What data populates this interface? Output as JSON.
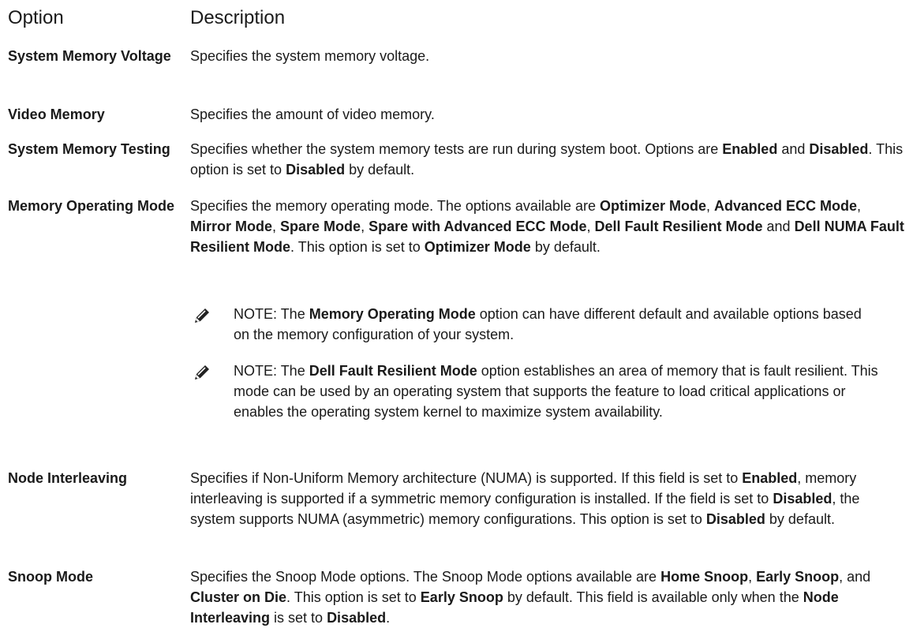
{
  "header": {
    "option": "Option",
    "description": "Description"
  },
  "rows": [
    {
      "option": "System Memory Voltage",
      "desc": [
        {
          "t": "Specifies the system memory voltage."
        }
      ]
    },
    {
      "option": "Video Memory",
      "desc": [
        {
          "t": "Specifies the amount of video memory."
        }
      ]
    },
    {
      "option": "System Memory Testing",
      "desc": [
        {
          "t": "Specifies whether the system memory tests are run during system boot. Options are "
        },
        {
          "t": "Enabled",
          "b": true
        },
        {
          "t": " and "
        },
        {
          "t": "Disabled",
          "b": true
        },
        {
          "t": ". This option is set to "
        },
        {
          "t": "Disabled",
          "b": true
        },
        {
          "t": " by default."
        }
      ]
    },
    {
      "option": "Memory Operating Mode",
      "desc": [
        {
          "t": "Specifies the memory operating mode. The options available are "
        },
        {
          "t": "Optimizer Mode",
          "b": true
        },
        {
          "t": ", "
        },
        {
          "t": "Advanced ECC Mode",
          "b": true
        },
        {
          "t": ", "
        },
        {
          "t": "Mirror Mode",
          "b": true
        },
        {
          "t": ", "
        },
        {
          "t": "Spare Mode",
          "b": true
        },
        {
          "t": ", "
        },
        {
          "t": "Spare with Advanced ECC Mode",
          "b": true
        },
        {
          "t": ", "
        },
        {
          "t": "Dell Fault Resilient Mode",
          "b": true
        },
        {
          "t": " and "
        },
        {
          "t": "Dell NUMA Fault Resilient Mode",
          "b": true
        },
        {
          "t": ". This option is set to "
        },
        {
          "t": "Optimizer Mode",
          "b": true
        },
        {
          "t": " by default."
        }
      ],
      "notes": [
        {
          "label": "NOTE:",
          "text": [
            {
              "t": " The "
            },
            {
              "t": "Memory Operating Mode",
              "b": true
            },
            {
              "t": " option can have different default and available options based on the memory configuration of your system."
            }
          ]
        },
        {
          "label": "NOTE:",
          "text": [
            {
              "t": " The "
            },
            {
              "t": "Dell Fault Resilient Mode",
              "b": true
            },
            {
              "t": " option establishes an area of memory that is fault resilient. This mode can be used by an operating system that supports the feature to load critical applications or enables the operating system kernel to maximize system availability."
            }
          ]
        }
      ]
    },
    {
      "option": "Node Interleaving",
      "desc": [
        {
          "t": "Specifies if Non-Uniform Memory architecture (NUMA) is supported. If this field is set to "
        },
        {
          "t": "Enabled",
          "b": true
        },
        {
          "t": ", memory interleaving is supported if a symmetric memory configuration is installed. If the field is set to "
        },
        {
          "t": "Disabled",
          "b": true
        },
        {
          "t": ", the system supports NUMA (asymmetric) memory configurations. This option is set to "
        },
        {
          "t": "Disabled",
          "b": true
        },
        {
          "t": " by default."
        }
      ]
    },
    {
      "option": "Snoop Mode",
      "desc": [
        {
          "t": "Specifies the Snoop Mode options. The Snoop Mode options available are "
        },
        {
          "t": "Home Snoop",
          "b": true
        },
        {
          "t": ", "
        },
        {
          "t": "Early Snoop",
          "b": true
        },
        {
          "t": ", and "
        },
        {
          "t": "Cluster on Die",
          "b": true
        },
        {
          "t": ". This option is set to "
        },
        {
          "t": "Early Snoop",
          "b": true
        },
        {
          "t": " by default. This field is available only when the "
        },
        {
          "t": "Node Interleaving",
          "b": true
        },
        {
          "t": " is set to "
        },
        {
          "t": "Disabled",
          "b": true
        },
        {
          "t": "."
        }
      ]
    }
  ]
}
